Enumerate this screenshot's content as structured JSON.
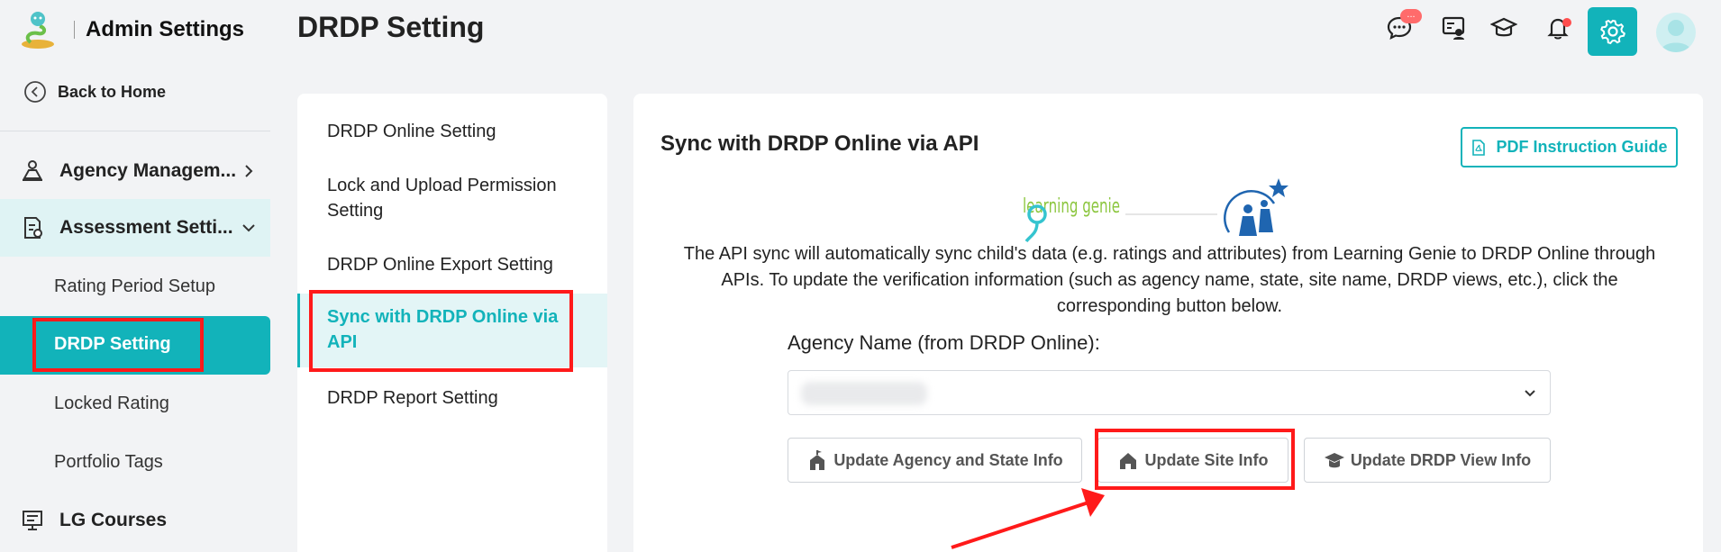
{
  "sidebar": {
    "app_title": "Admin Settings",
    "back_home": "Back to Home",
    "nav": [
      {
        "label": "Agency Managem...",
        "icon": "agency-icon"
      },
      {
        "label": "Assessment Setti...",
        "icon": "assessment-icon"
      },
      {
        "label": "LG Courses",
        "icon": "courses-icon"
      }
    ],
    "sub_items": [
      "Rating Period Setup",
      "DRDP Setting",
      "Locked Rating",
      "Portfolio Tags"
    ]
  },
  "header": {
    "page_title": "DRDP Setting",
    "message_badge": "...",
    "icons": [
      "chat-icon",
      "message-board-icon",
      "graduation-cap-icon",
      "bell-icon",
      "gear-icon",
      "avatar-icon"
    ]
  },
  "menu": {
    "items": [
      "DRDP Online Setting",
      "Lock and Upload Permission Setting",
      "DRDP Online Export Setting",
      "Sync with DRDP Online via API",
      "DRDP Report Setting"
    ]
  },
  "content": {
    "title": "Sync with DRDP Online via API",
    "pdf_button": "PDF Instruction Guide",
    "logo_text": "learning genie",
    "description": "The API sync will automatically sync child's data (e.g. ratings and attributes) from Learning Genie to DRDP Online through APIs. To update the verification information (such as agency name, state, site name, DRDP views, etc.), click the corresponding button below.",
    "agency_label": "Agency Name (from DRDP Online):",
    "buttons": {
      "agency_state": "Update Agency and State Info",
      "site": "Update Site Info",
      "drdp_view": "Update DRDP View Info"
    }
  },
  "colors": {
    "accent": "#12b3ba",
    "highlight": "#ff1a1a",
    "active_bg": "#dff3f4"
  }
}
